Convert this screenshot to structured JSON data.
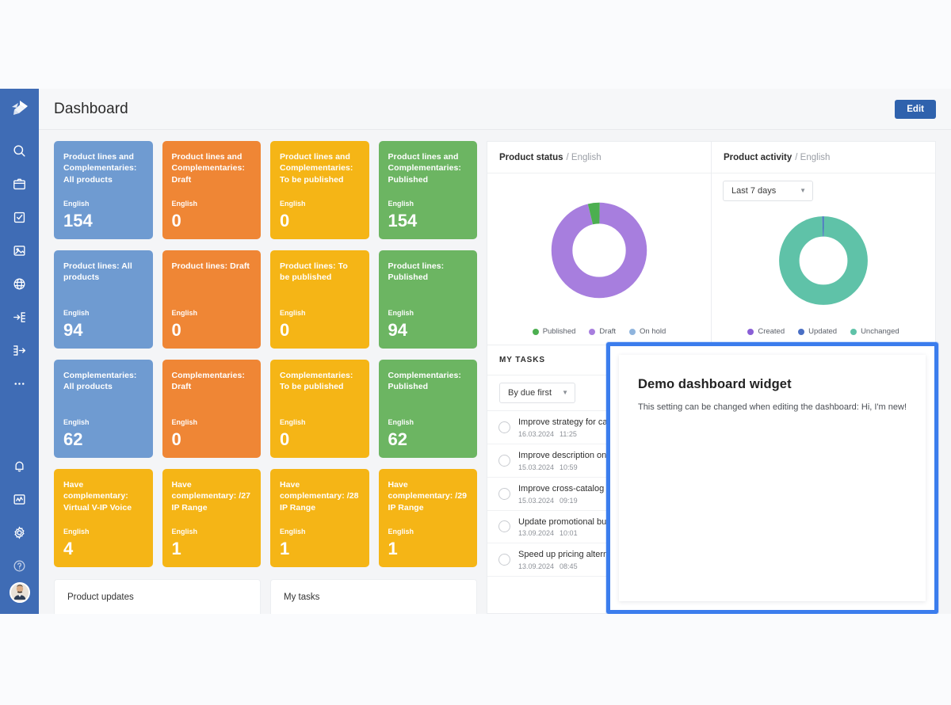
{
  "app": {
    "title": "Dashboard",
    "edit_label": "Edit",
    "logo_icon": "origami-logo-icon"
  },
  "sidebar": {
    "items": [
      {
        "icon": "search-icon",
        "name": "search"
      },
      {
        "icon": "box-icon",
        "name": "products"
      },
      {
        "icon": "clipboard-check-icon",
        "name": "tasks"
      },
      {
        "icon": "image-icon",
        "name": "media"
      },
      {
        "icon": "globe-icon",
        "name": "channels"
      },
      {
        "icon": "import-icon",
        "name": "import"
      },
      {
        "icon": "export-icon",
        "name": "export"
      },
      {
        "icon": "ellipsis-icon",
        "name": "more"
      }
    ],
    "bottom_items": [
      {
        "icon": "bell-icon",
        "name": "notifications"
      },
      {
        "icon": "analytics-icon",
        "name": "analytics"
      },
      {
        "icon": "gear-icon",
        "name": "settings"
      },
      {
        "icon": "help-icon",
        "name": "help"
      }
    ],
    "avatar": "user-avatar"
  },
  "tiles": [
    {
      "title": "Product lines and Complementaries: All products",
      "lang": "English",
      "value": "154",
      "color": "blue"
    },
    {
      "title": "Product lines and Complementaries: Draft",
      "lang": "English",
      "value": "0",
      "color": "orange"
    },
    {
      "title": "Product lines and Complementaries: To be published",
      "lang": "English",
      "value": "0",
      "color": "yellow"
    },
    {
      "title": "Product lines and Complementaries: Published",
      "lang": "English",
      "value": "154",
      "color": "green"
    },
    {
      "title": "Product lines: All products",
      "lang": "English",
      "value": "94",
      "color": "blue"
    },
    {
      "title": "Product lines: Draft",
      "lang": "English",
      "value": "0",
      "color": "orange"
    },
    {
      "title": "Product lines: To be published",
      "lang": "English",
      "value": "0",
      "color": "yellow"
    },
    {
      "title": "Product lines: Published",
      "lang": "English",
      "value": "94",
      "color": "green"
    },
    {
      "title": "Complementaries: All products",
      "lang": "English",
      "value": "62",
      "color": "blue"
    },
    {
      "title": "Complementaries: Draft",
      "lang": "English",
      "value": "0",
      "color": "orange"
    },
    {
      "title": "Complementaries: To be published",
      "lang": "English",
      "value": "0",
      "color": "yellow"
    },
    {
      "title": "Complementaries: Published",
      "lang": "English",
      "value": "62",
      "color": "green"
    },
    {
      "title": "Have complementary: Virtual V-IP Voice",
      "lang": "English",
      "value": "4",
      "color": "yellow"
    },
    {
      "title": "Have complementary: /27 IP Range",
      "lang": "English",
      "value": "1",
      "color": "yellow"
    },
    {
      "title": "Have complementary: /28 IP Range",
      "lang": "English",
      "value": "1",
      "color": "yellow"
    },
    {
      "title": "Have complementary: /29 IP Range",
      "lang": "English",
      "value": "1",
      "color": "yellow"
    }
  ],
  "stubs": [
    {
      "label": "Product updates"
    },
    {
      "label": "My tasks"
    }
  ],
  "product_status": {
    "title": "Product status",
    "subtitle": "/ English"
  },
  "product_activity": {
    "title": "Product activity",
    "subtitle": "/ English",
    "range_value": "Last 7 days",
    "range_options": [
      "Last 7 days"
    ]
  },
  "tasks": {
    "heading": "MY TASKS",
    "sort_value": "By due first",
    "sort_options": [
      "By due first"
    ],
    "rows": [
      {
        "title": "Improve strategy for catalog...",
        "date": "16.03.2024",
        "time": "11:25",
        "starred": true,
        "star_glyph": "★"
      },
      {
        "title": "Improve description on All...",
        "date": "15.03.2024",
        "time": "10:59",
        "starred": false,
        "star_glyph": "☆"
      },
      {
        "title": "Improve cross-catalog sharing",
        "date": "15.03.2024",
        "time": "09:19",
        "starred": true,
        "star_glyph": "★"
      },
      {
        "title": "Update promotional bundle...",
        "date": "13.09.2024",
        "time": "10:01",
        "starred": false,
        "star_glyph": "☆"
      },
      {
        "title": "Speed up pricing alternations",
        "date": "13.09.2024",
        "time": "08:45",
        "starred": false,
        "star_glyph": "☆"
      }
    ]
  },
  "demo_widget": {
    "title": "Demo dashboard widget",
    "body": "This setting can be changed when editing the dashboard: Hi, I'm new!",
    "selected": true,
    "selection_color": "#3b7ded"
  },
  "chart_data": [
    {
      "type": "pie",
      "title": "Product status",
      "subtitle": "/ English",
      "legend_position": "bottom",
      "labels": [
        "Published",
        "Draft",
        "On hold"
      ],
      "values": [
        4,
        96,
        0
      ],
      "colors": [
        "#4caf50",
        "#a77ede",
        "#8fb4dd"
      ],
      "donut": true
    },
    {
      "type": "pie",
      "title": "Product activity",
      "subtitle": "/ English",
      "legend_position": "bottom",
      "labels": [
        "Created",
        "Updated",
        "Unchanged"
      ],
      "values": [
        0,
        0.6,
        99.4
      ],
      "colors": [
        "#8a5fd6",
        "#4a6fc4",
        "#5fc2a8"
      ],
      "donut": true
    }
  ],
  "colors": {
    "sidebar": "#3f6cb5",
    "accent": "#2f62ad",
    "selection": "#3b7ded"
  }
}
